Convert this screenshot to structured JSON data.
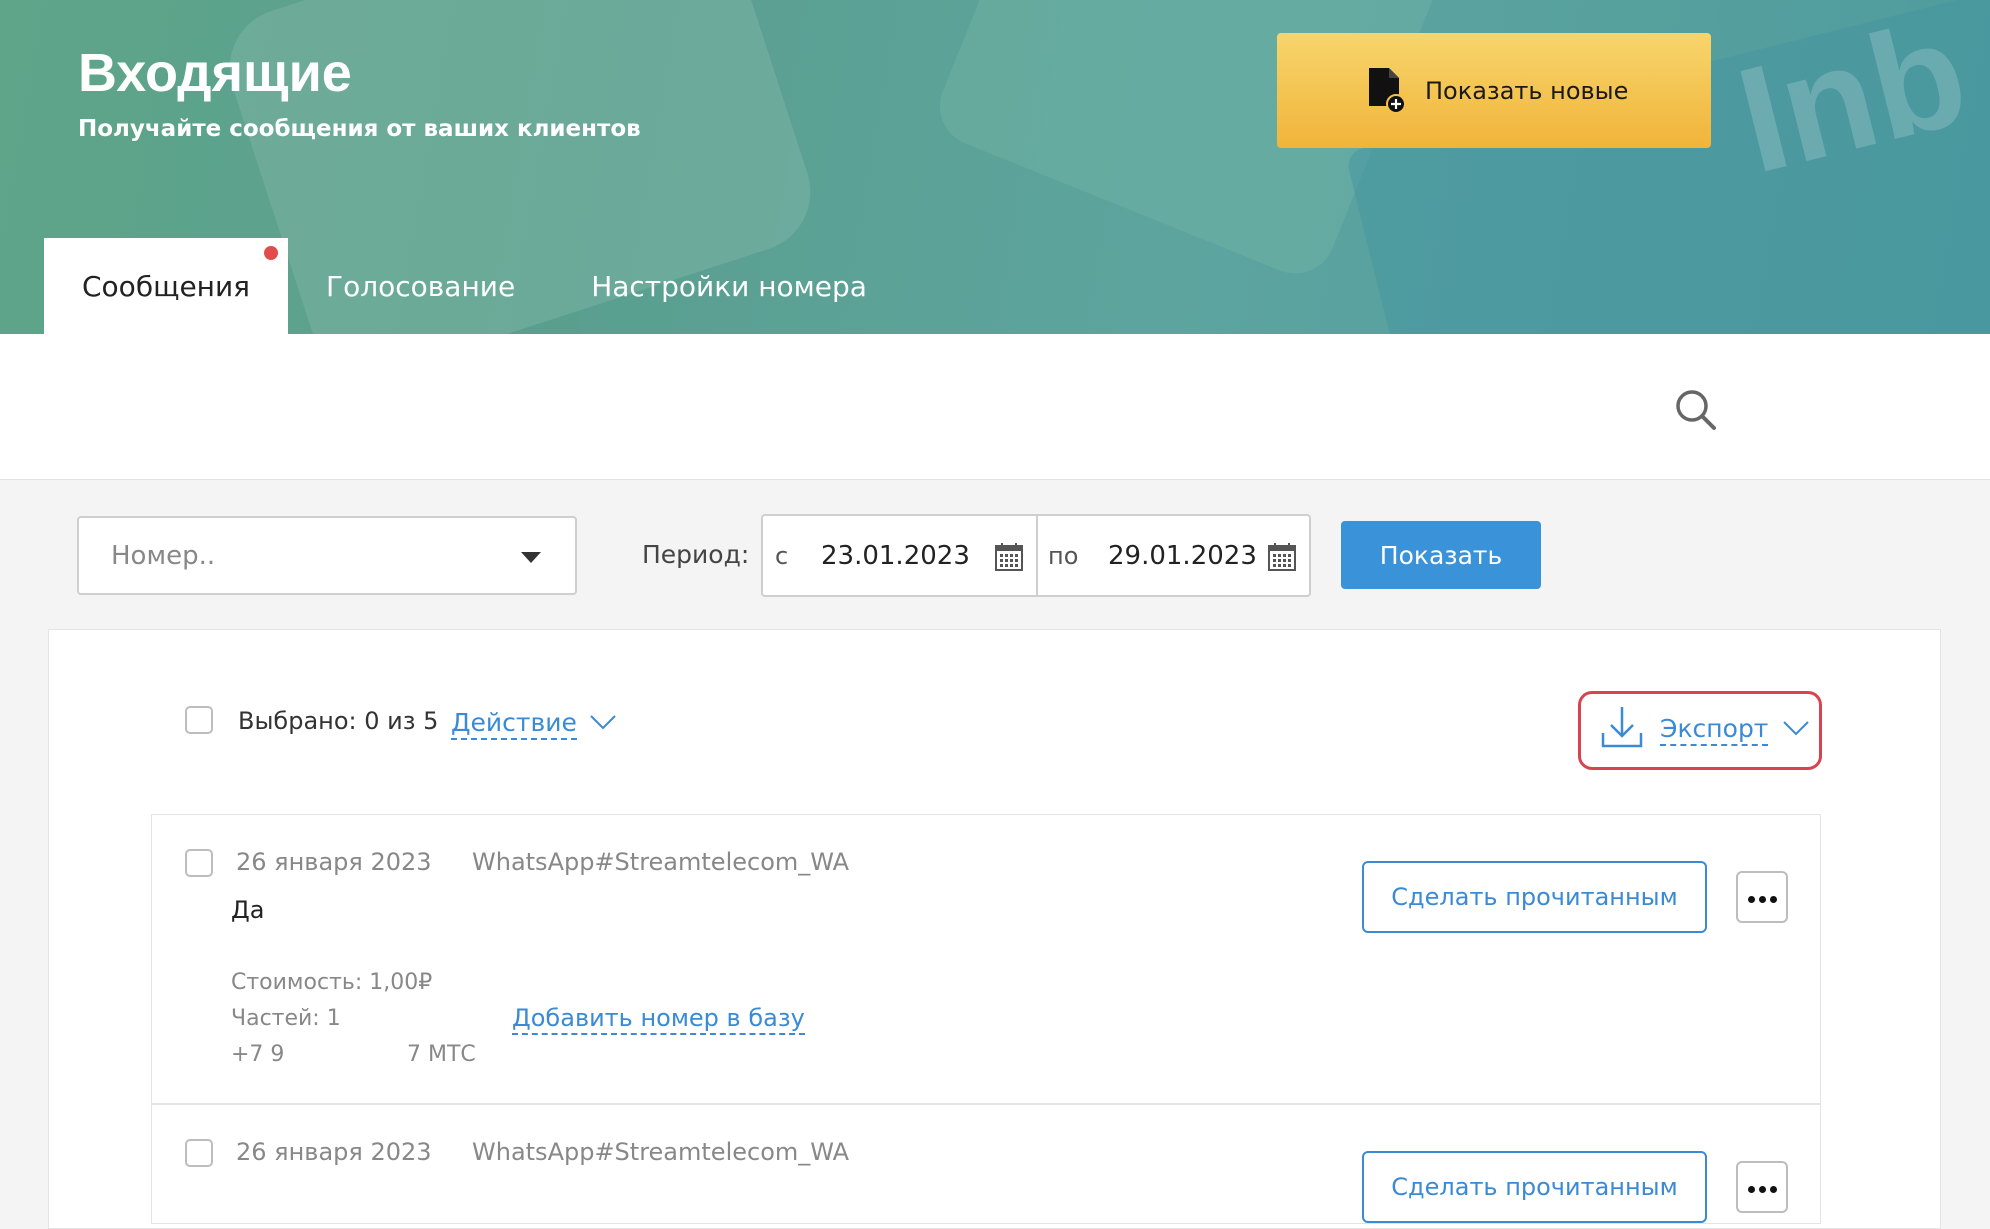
{
  "header": {
    "title": "Входящие",
    "subtitle": "Получайте сообщения от ваших клиентов",
    "show_new_label": "Показать новые",
    "background_watermark": "Inb"
  },
  "tabs": [
    {
      "label": "Сообщения",
      "active": true,
      "has_notification": true
    },
    {
      "label": "Голосование",
      "active": false
    },
    {
      "label": "Настройки номера",
      "active": false
    }
  ],
  "search": {
    "icon": "search-icon"
  },
  "filters": {
    "number_placeholder": "Номер..",
    "period_label": "Период:",
    "from_prefix": "с",
    "from_date": "23.01.2023",
    "to_prefix": "по",
    "to_date": "29.01.2023",
    "show_button": "Показать"
  },
  "toolbar": {
    "selected_text": "Выбрано: 0 из 5",
    "action_label": "Действие",
    "export_label": "Экспорт"
  },
  "messages": [
    {
      "date": "26 января 2023",
      "sender": "WhatsApp#Streamtelecom_WA",
      "text": "Да",
      "cost": "Стоимость: 1,00₽",
      "parts": "Частей: 1",
      "phone": "+7 9",
      "operator": "7 МТС",
      "add_to_base": "Добавить номер в базу",
      "read_button": "Сделать прочитанным"
    },
    {
      "date": "26 января 2023",
      "sender": "WhatsApp#Streamtelecom_WA",
      "read_button": "Сделать прочитанным"
    }
  ],
  "colors": {
    "accent_blue": "#3a93d8",
    "link_blue": "#3a8ad6",
    "cta_yellow": "#f1b43a",
    "highlight_red": "#d9434f",
    "notification_red": "#e24b4b"
  }
}
